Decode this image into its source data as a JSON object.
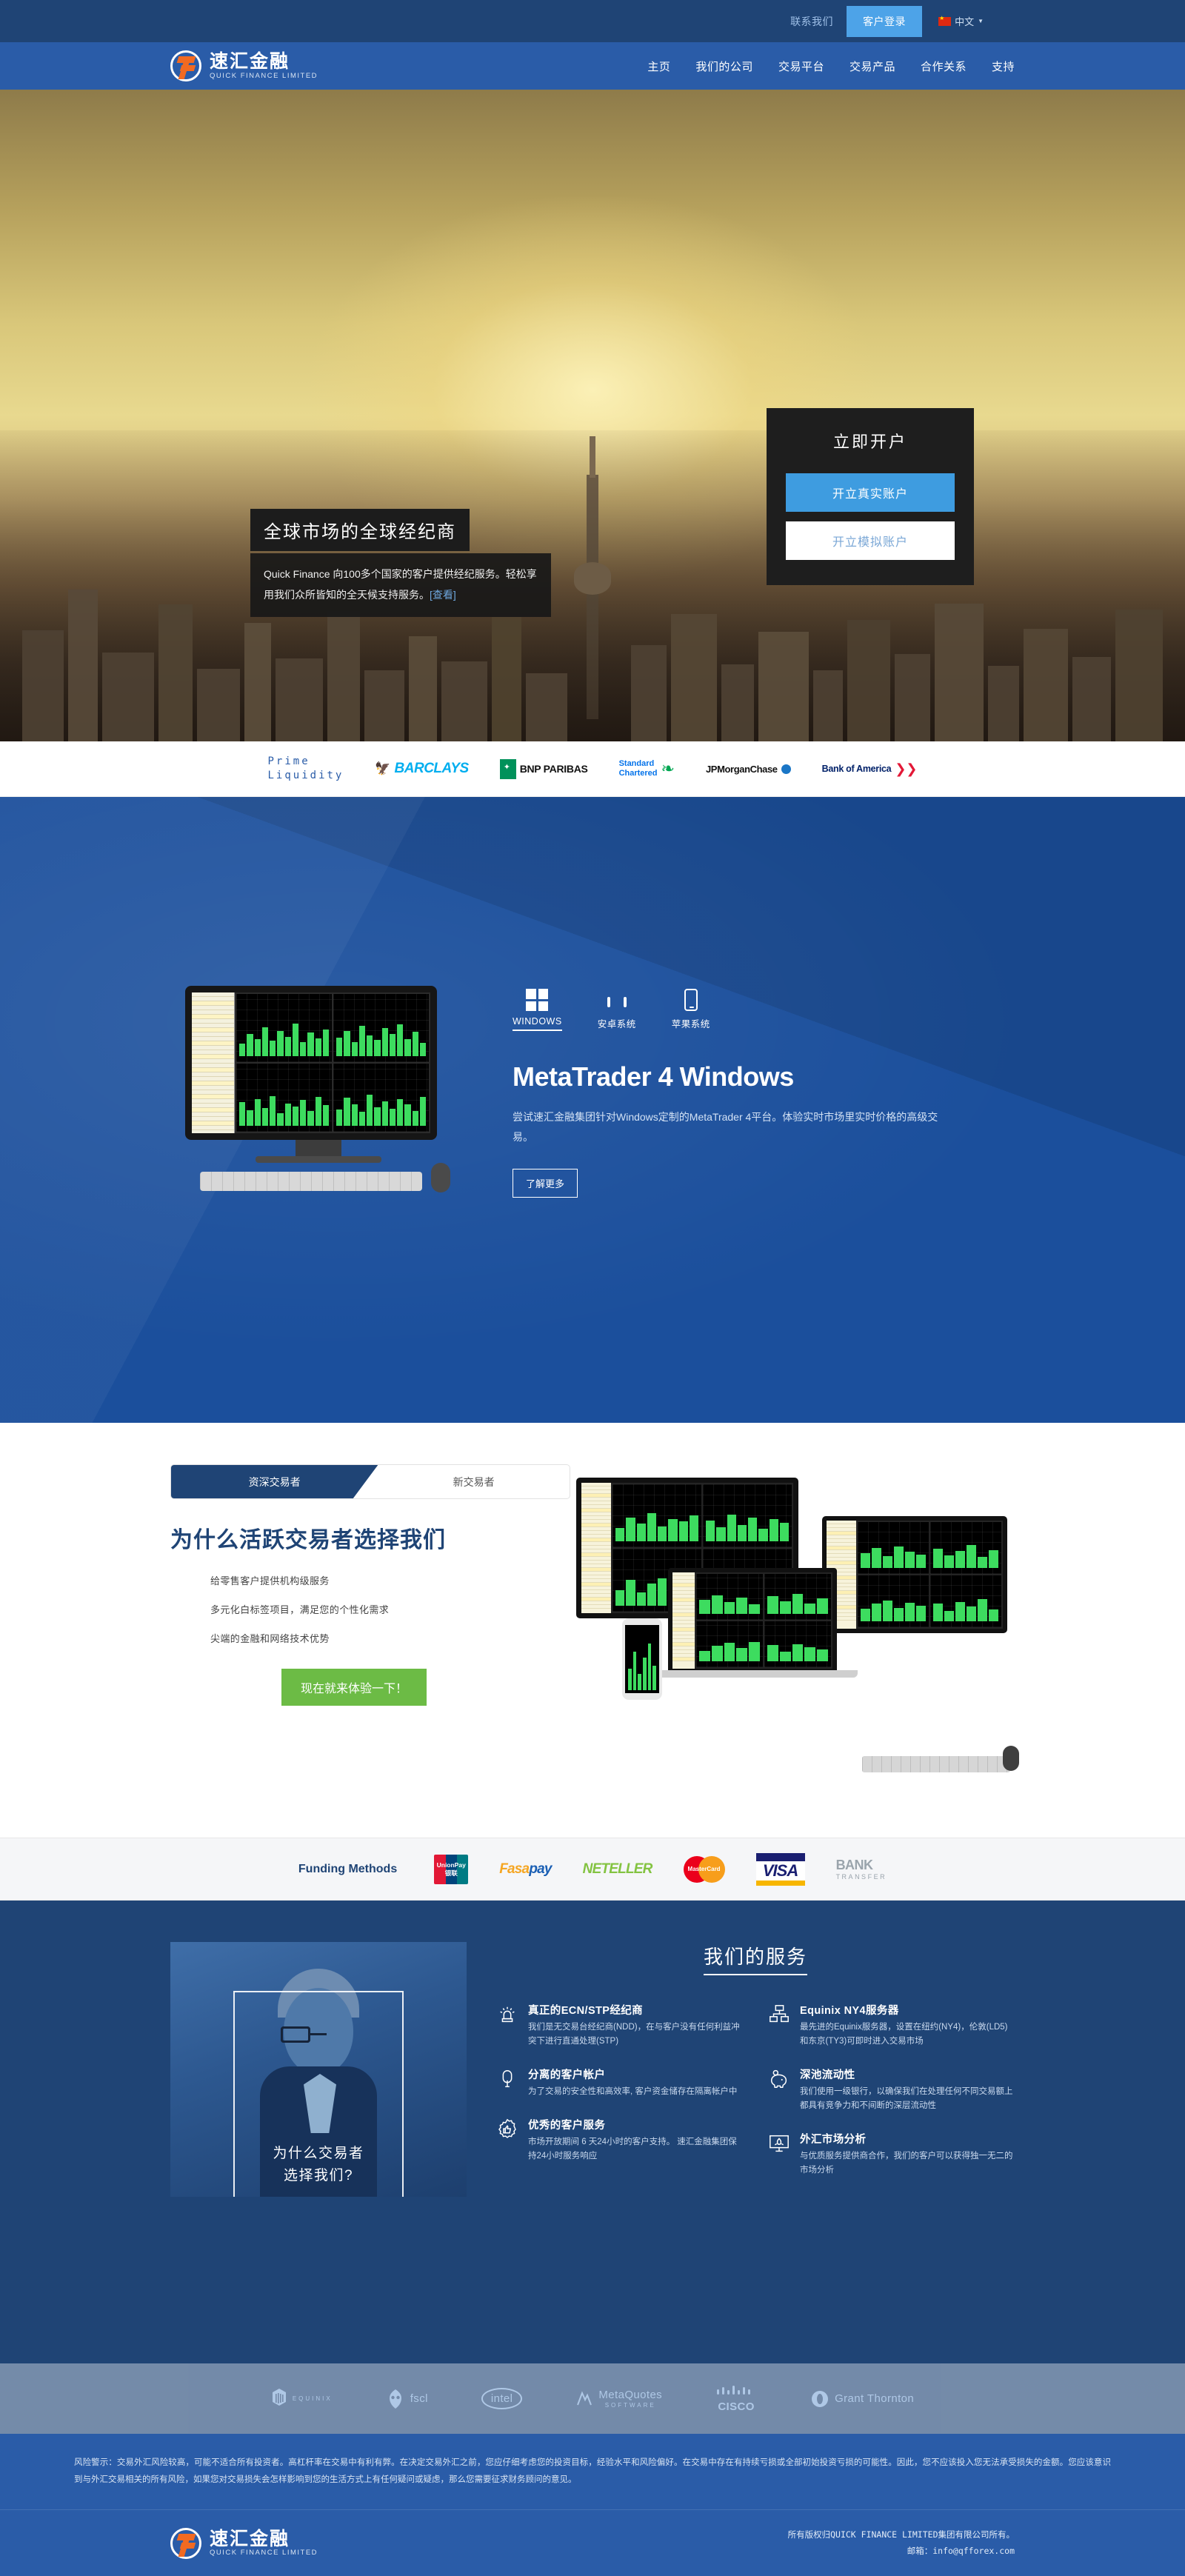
{
  "topbar": {
    "contact": "联系我们",
    "login": "客户登录",
    "language": "中文",
    "flag_icon": "china-flag-icon",
    "caret_icon": "chevron-down-icon"
  },
  "brand": {
    "name_cn": "速汇金融",
    "name_en": "QUICK FINANCE LIMITED",
    "logo_icon": "quick-finance-f-logo",
    "accent": "#f26a21",
    "primary": "#2a5ca8",
    "dark": "#1f4475"
  },
  "nav": {
    "items": [
      {
        "label": "主页"
      },
      {
        "label": "我们的公司"
      },
      {
        "label": "交易平台"
      },
      {
        "label": "交易产品"
      },
      {
        "label": "合作关系"
      },
      {
        "label": "支持"
      }
    ]
  },
  "hero": {
    "headline": "全球市场的全球经纪商",
    "subtext": "Quick Finance 向100多个国家的客户提供经纪服务。轻松享用我们众所皆知的全天候支持服务。",
    "subtext_link": "[查看]",
    "account_card": {
      "title": "立即开户",
      "real_button": "开立真实账户",
      "demo_button": "开立模拟账户",
      "real_color": "#3e9ce0"
    }
  },
  "prime_liquidity": {
    "label_line1": "Prime",
    "label_line2": "Liquidity",
    "banks": [
      {
        "name": "BARCLAYS",
        "icon": "barclays-eagle-icon"
      },
      {
        "name": "BNP PARIBAS",
        "icon": "bnp-paribas-icon"
      },
      {
        "name": "Standard Chartered",
        "line1": "Standard",
        "line2": "Chartered",
        "icon": "standard-chartered-icon"
      },
      {
        "name": "JPMorganChase",
        "icon": "jpmorgan-chase-icon"
      },
      {
        "name": "Bank of America",
        "icon": "bank-of-america-flag-icon"
      }
    ]
  },
  "metatrader": {
    "platforms": [
      {
        "label": "WINDOWS",
        "icon": "windows-icon",
        "active": true
      },
      {
        "label": "安卓系统",
        "icon": "android-icon",
        "active": false
      },
      {
        "label": "苹果系统",
        "icon": "apple-phone-icon",
        "active": false
      }
    ],
    "title": "MetaTrader 4 Windows",
    "description": "尝试速汇金融集团针对Windows定制的MetaTrader 4平台。体验实时市场里实时价格的高级交易。",
    "cta": "了解更多"
  },
  "why": {
    "tabs": [
      {
        "label": "资深交易者",
        "active": true
      },
      {
        "label": "新交易者",
        "active": false
      }
    ],
    "title": "为什么活跃交易者选择我们",
    "bullets": [
      "给零售客户提供机构级服务",
      "多元化白标签项目，满足您的个性化需求",
      "尖端的金融和网络技术优势"
    ],
    "cta": "现在就来体验一下！",
    "cta_color": "#6cbb45"
  },
  "funding": {
    "label": "Funding Methods",
    "methods": [
      {
        "name": "UnionPay",
        "line1": "UnionPay",
        "line2": "银联",
        "icon": "unionpay-icon"
      },
      {
        "name": "FasaPay",
        "part1": "Fasa",
        "part2": "pay",
        "icon": "fasapay-icon"
      },
      {
        "name": "NETELLER",
        "icon": "neteller-icon"
      },
      {
        "name": "MasterCard",
        "icon": "mastercard-icon"
      },
      {
        "name": "VISA",
        "icon": "visa-icon"
      },
      {
        "name": "BANK TRANSFER",
        "line1": "BANK",
        "line2": "TRANSFER",
        "icon": "bank-transfer-icon"
      }
    ]
  },
  "services": {
    "photo_caption_line1": "为什么交易者",
    "photo_caption_line2": "选择我们?",
    "title": "我们的服务",
    "left_items": [
      {
        "icon": "handshake-quality-icon",
        "heading": "真正的ECN/STP经纪商",
        "body": "我们是无交易台经纪商(NDD)，在与客户没有任何利益冲突下进行直通处理(STP)"
      },
      {
        "icon": "vault-lock-icon",
        "heading": "分离的客户帐户",
        "body": "为了交易的安全性和高效率, 客户资金储存在隔离帐户中"
      },
      {
        "icon": "thumbs-up-icon",
        "heading": "优秀的客户服务",
        "body": "市场开放期间 6 天24小时的客户支持。 速汇金融集团保持24小时服务响应"
      }
    ],
    "right_items": [
      {
        "icon": "servers-network-icon",
        "heading": "Equinix NY4服务器",
        "body": "最先进的Equinix服务器，设置在纽约(NY4)，伦敦(LD5)和东京(TY3)可即时进入交易市场"
      },
      {
        "icon": "piggy-bank-icon",
        "heading": "深池流动性",
        "body": "我们使用一级银行，以确保我们在处理任何不同交易额上都具有竞争力和不间断的深层流动性"
      },
      {
        "icon": "market-analysis-icon",
        "heading": "外汇市场分析",
        "body": "与优质服务提供商合作，我们的客户可以获得独一无二的市场分析"
      }
    ]
  },
  "partners": [
    {
      "name": "EQUINIX",
      "sub": "EQUINIX",
      "icon": "equinix-icon"
    },
    {
      "name": "fscl",
      "icon": "fscl-icon"
    },
    {
      "name": "intel",
      "icon": "intel-icon"
    },
    {
      "name": "MetaQuotes",
      "sub": "SOFTWARE",
      "icon": "metaquotes-icon"
    },
    {
      "name": "CISCO",
      "icon": "cisco-icon"
    },
    {
      "name": "Grant Thornton",
      "icon": "grant-thornton-icon"
    }
  ],
  "disclaimer": "风险警示：交易外汇风险较高，可能不适合所有投资者。高杠杆率在交易中有利有弊。在决定交易外汇之前，您应仔细考虑您的投资目标，经验水平和风险偏好。在交易中存在有持续亏损或全部初始投资亏损的可能性。因此，您不应该投入您无法承受损失的金额。您应该意识到与外汇交易相关的所有风险，如果您对交易损失会怎样影响到您的生活方式上有任何疑问或疑虑，那么您需要征求财务顾问的意见。",
  "footer": {
    "copyright": "所有版权归QUICK FINANCE LIMITED集团有限公司所有。",
    "email_label": "邮箱：",
    "email": "info@qfforex.com"
  }
}
